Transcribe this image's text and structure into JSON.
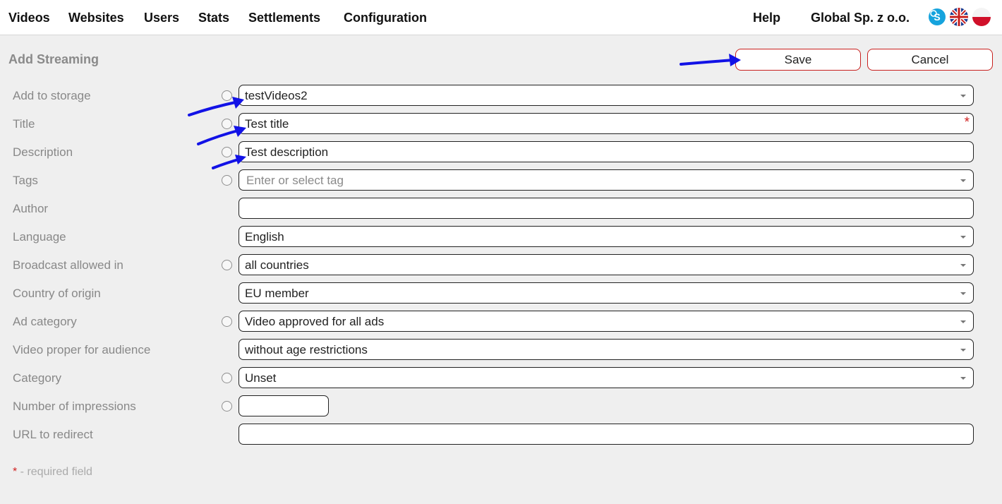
{
  "nav": {
    "items": [
      {
        "label": "Videos"
      },
      {
        "label": "Websites"
      },
      {
        "label": "Users"
      },
      {
        "label": "Stats"
      },
      {
        "label": "Settlements"
      },
      {
        "label": "Configuration"
      }
    ],
    "help": "Help",
    "company": "Global Sp. z o.o.",
    "icons": [
      "skype-icon",
      "uk-flag-icon",
      "pl-flag-icon"
    ]
  },
  "page": {
    "title": "Add Streaming",
    "save_label": "Save",
    "cancel_label": "Cancel"
  },
  "form": {
    "add_to_storage": {
      "label": "Add to storage",
      "value": "testVideos2"
    },
    "title": {
      "label": "Title",
      "value": "Test title",
      "required": "*"
    },
    "description": {
      "label": "Description",
      "value": "Test description"
    },
    "tags": {
      "label": "Tags",
      "placeholder": "Enter or select tag"
    },
    "author": {
      "label": "Author",
      "value": ""
    },
    "language": {
      "label": "Language",
      "value": "English"
    },
    "broadcast": {
      "label": "Broadcast allowed in",
      "value": "all countries"
    },
    "country": {
      "label": "Country of origin",
      "value": "EU member"
    },
    "ad_category": {
      "label": "Ad category",
      "value": "Video approved for all ads"
    },
    "audience": {
      "label": "Video proper for audience",
      "value": "without age restrictions"
    },
    "category": {
      "label": "Category",
      "value": "Unset"
    },
    "impressions": {
      "label": "Number of impressions",
      "value": ""
    },
    "url": {
      "label": "URL to redirect",
      "value": ""
    }
  },
  "footnote": {
    "star": "*",
    "text": " - required field"
  },
  "colors": {
    "accent_border": "#c8201e",
    "arrow": "#1212e6",
    "required": "#d02020"
  }
}
